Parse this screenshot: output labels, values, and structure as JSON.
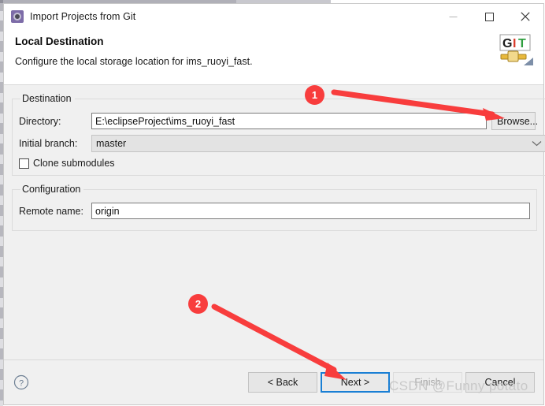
{
  "window": {
    "title": "Import Projects from Git",
    "icon": "eclipse-import-icon",
    "controls": {
      "minimize": "minimize-icon",
      "maximize": "maximize-icon",
      "close": "close-icon"
    }
  },
  "banner": {
    "title": "Local Destination",
    "subtitle": "Configure the local storage location for ims_ruoyi_fast.",
    "logo": {
      "g": "G",
      "i": "I",
      "t": "T",
      "alt": "git-logo"
    }
  },
  "destination": {
    "legend": "Destination",
    "directory_label": "Directory:",
    "directory_value": "E:\\eclipseProject\\ims_ruoyi_fast",
    "directory_placeholder": "",
    "browse_label": "Browse...",
    "branch_label": "Initial branch:",
    "branch_value": "master",
    "branch_options": [
      "master"
    ],
    "clone_submodules_label": "Clone submodules",
    "clone_submodules_checked": false
  },
  "configuration": {
    "legend": "Configuration",
    "remote_label": "Remote name:",
    "remote_value": "origin",
    "remote_placeholder": ""
  },
  "footer": {
    "help_icon": "help-icon",
    "back_label": "< Back",
    "next_label": "Next >",
    "finish_label": "Finish",
    "cancel_label": "Cancel",
    "finish_disabled": true,
    "next_focused": true
  },
  "annotations": {
    "marker_1": "1",
    "marker_2": "2",
    "accent_color": "#f83d3d"
  },
  "watermark": "CSDN @Funny potato"
}
